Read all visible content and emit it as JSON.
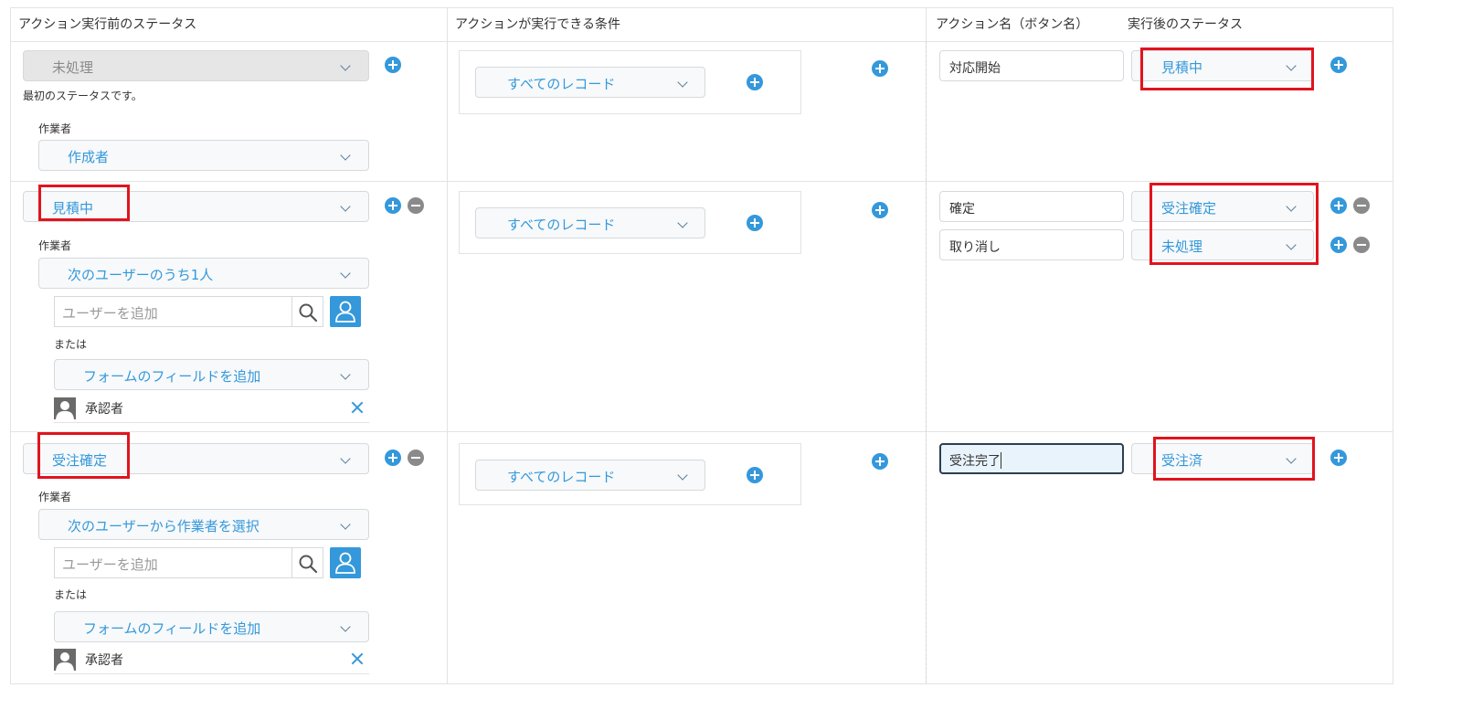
{
  "headers": {
    "before_status": "アクション実行前のステータス",
    "condition": "アクションが実行できる条件",
    "action_name": "アクション名（ボタン名）",
    "after_status": "実行後のステータス"
  },
  "common": {
    "assignee_label": "作業者",
    "or_label": "または",
    "add_user_placeholder": "ユーザーを追加",
    "add_field_label": "フォームのフィールドを追加",
    "all_records": "すべてのレコード"
  },
  "rows": [
    {
      "status": "未処理",
      "note": "最初のステータスです。",
      "assignee_type": "作成者",
      "actions": [
        {
          "name": "対応開始",
          "next_status": "見積中"
        }
      ]
    },
    {
      "status": "見積中",
      "assignee_type": "次のユーザーのうち1人",
      "approver": "承認者",
      "actions": [
        {
          "name": "確定",
          "next_status": "受注確定"
        },
        {
          "name": "取り消し",
          "next_status": "未処理"
        }
      ]
    },
    {
      "status": "受注確定",
      "assignee_type": "次のユーザーから作業者を選択",
      "approver": "承認者",
      "actions": [
        {
          "name": "受注完了",
          "next_status": "受注済"
        }
      ]
    }
  ],
  "colors": {
    "accent": "#3498db",
    "highlight": "#e0141e",
    "border": "#e3e3e3"
  },
  "icons": [
    "plus-icon",
    "minus-icon",
    "chevron-down-icon",
    "search-icon",
    "user-picker-icon",
    "avatar-icon",
    "close-icon"
  ]
}
